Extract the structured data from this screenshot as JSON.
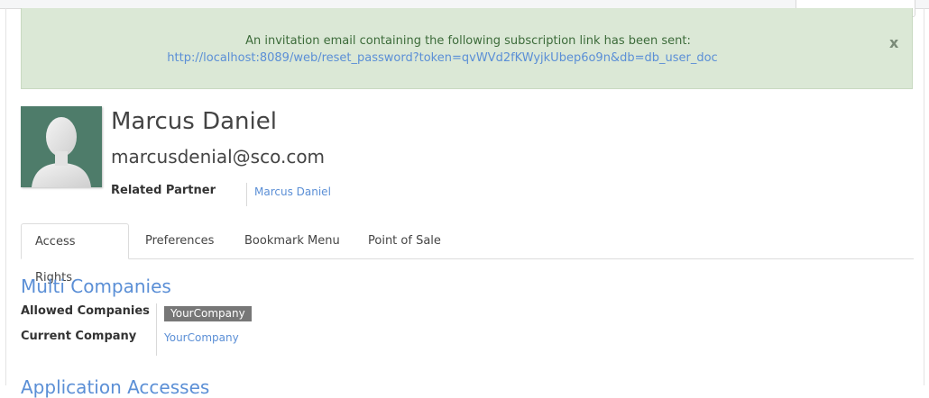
{
  "alert": {
    "message": "An invitation email containing the following subscription link has been sent:",
    "link": "http://localhost:8089/web/reset_password?token=qvWVd2fKWyjkUbep6o9n&db=db_user_doc",
    "close": "x"
  },
  "user": {
    "name": "Marcus Daniel",
    "email": "marcusdenial@sco.com",
    "avatar_icon": "user-silhouette-icon"
  },
  "related_partner": {
    "label": "Related Partner",
    "value": "Marcus Daniel"
  },
  "tabs": [
    {
      "label": "Access Rights",
      "active": true
    },
    {
      "label": "Preferences",
      "active": false
    },
    {
      "label": "Bookmark Menu",
      "active": false
    },
    {
      "label": "Point of Sale",
      "active": false
    }
  ],
  "multi_companies": {
    "title": "Multi Companies",
    "allowed_label": "Allowed Companies",
    "allowed_value": "YourCompany",
    "current_label": "Current Company",
    "current_value": "YourCompany"
  },
  "next_section": {
    "title": "Application Accesses"
  },
  "colors": {
    "alert_bg": "#dbe8d6",
    "link": "#5b8fd6",
    "badge_bg": "#777777"
  }
}
